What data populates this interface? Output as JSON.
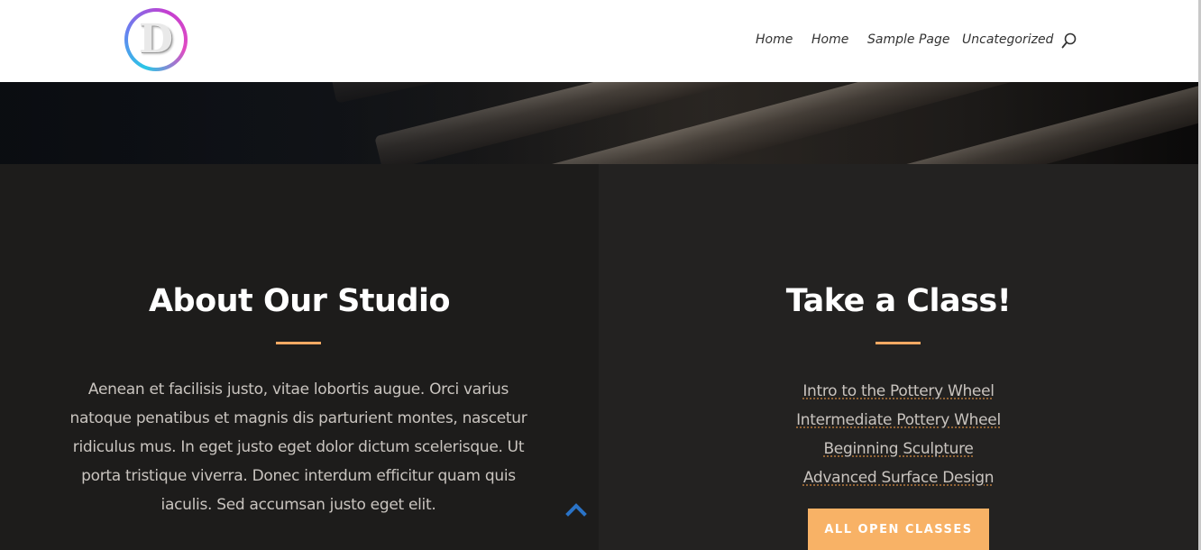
{
  "header": {
    "logo_letter": "D",
    "nav": [
      {
        "label": "Home"
      },
      {
        "label": "Home"
      },
      {
        "label": "Sample Page"
      },
      {
        "label": "Uncategorized"
      }
    ],
    "search_icon": "search-icon"
  },
  "about": {
    "heading": "About Our Studio",
    "text": "Aenean et facilisis justo, vitae lobortis augue. Orci varius natoque penatibus et magnis dis parturient montes, nascetur ridiculus mus. In eget justo eget dolor dictum scelerisque. Ut porta tristique viverra. Donec interdum efficitur quam quis iaculis. Sed accumsan justo eget elit."
  },
  "classes": {
    "heading": "Take a Class!",
    "links": [
      {
        "label": "Intro to the Pottery Wheel"
      },
      {
        "label": "Intermediate Pottery Wheel"
      },
      {
        "label": "Beginning Sculpture"
      },
      {
        "label": "Advanced Surface Design"
      }
    ],
    "cta_label": "ALL OPEN CLASSES"
  },
  "back_to_top_icon": "chevron-up-icon",
  "colors": {
    "accent": "#f8b266",
    "divider": "#f8a963",
    "dark_left": "#1d1c1b",
    "dark_right": "#232221",
    "back_to_top": "#2a73c7"
  }
}
